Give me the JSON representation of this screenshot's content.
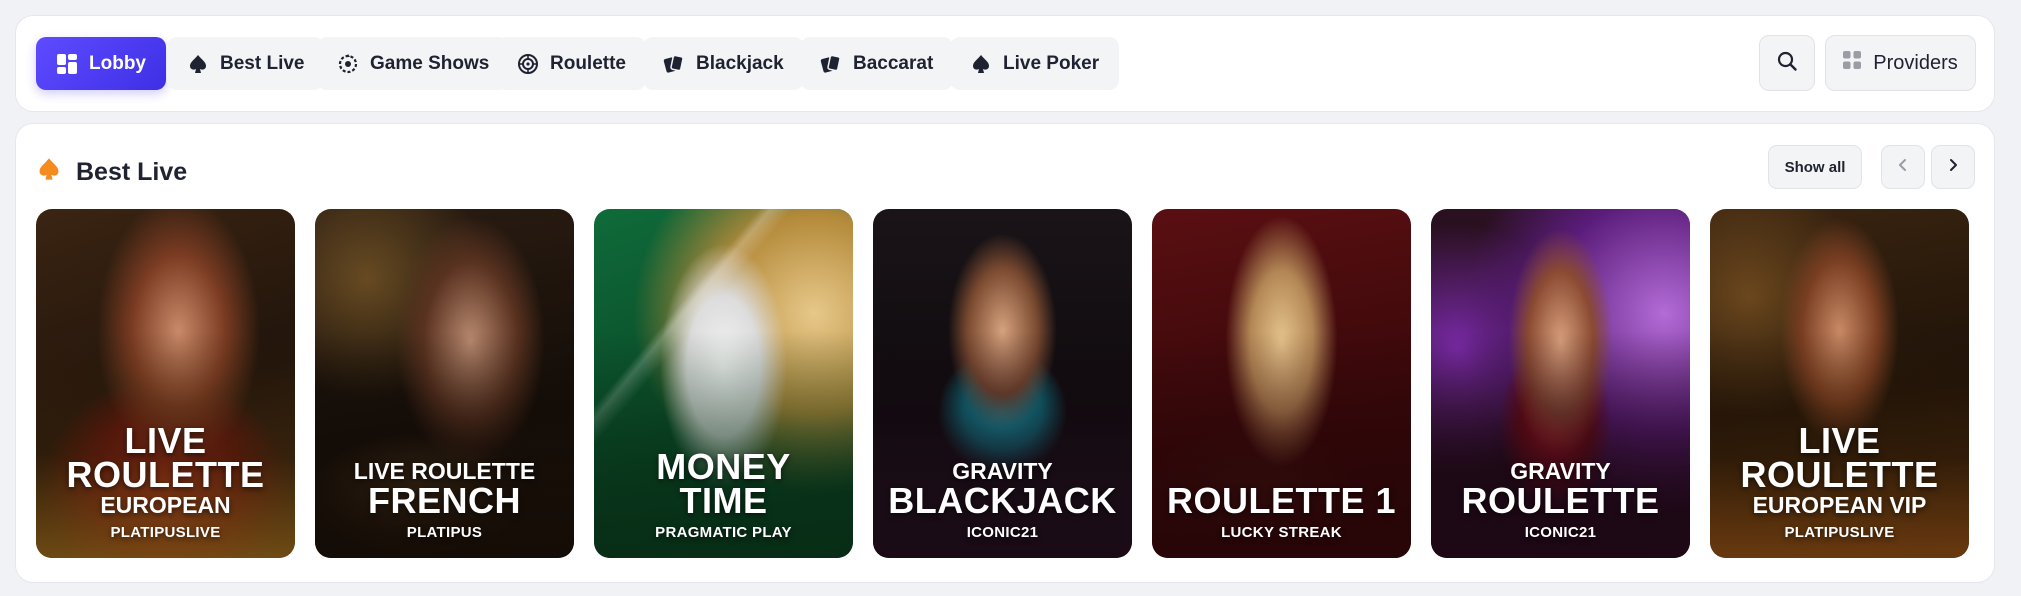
{
  "nav": {
    "tabs": [
      {
        "label": "Lobby",
        "icon": "grid-icon",
        "active": true
      },
      {
        "label": "Best Live",
        "icon": "spade-icon",
        "active": false
      },
      {
        "label": "Game Shows",
        "icon": "wheel-icon",
        "active": false
      },
      {
        "label": "Roulette",
        "icon": "roulette-icon",
        "active": false
      },
      {
        "label": "Blackjack",
        "icon": "cards-icon",
        "active": false
      },
      {
        "label": "Baccarat",
        "icon": "cards-icon",
        "active": false
      },
      {
        "label": "Live Poker",
        "icon": "spade-icon",
        "active": false
      }
    ],
    "search_icon": "search-icon",
    "providers_label": "Providers"
  },
  "section": {
    "title": "Best Live",
    "icon": "spade-icon",
    "accent_color": "#f58a1f",
    "show_all_label": "Show all"
  },
  "games": [
    {
      "lines": [
        "LIVE",
        "ROULETTE",
        "EUROPEAN"
      ],
      "provider": "PLATIPUSLIVE",
      "theme": "red-gold"
    },
    {
      "lines": [
        "LIVE ROULETTE",
        "FRENCH"
      ],
      "provider": "PLATIPUS",
      "theme": "dark-gold"
    },
    {
      "lines": [
        "MONEY",
        "TIME"
      ],
      "provider": "PRAGMATIC PLAY",
      "theme": "green"
    },
    {
      "lines": [
        "GRAVITY",
        "BLACKJACK"
      ],
      "provider": "ICONIC21",
      "theme": "teal-dark"
    },
    {
      "lines": [
        "ROULETTE 1"
      ],
      "provider": "LUCKY STREAK",
      "theme": "crimson"
    },
    {
      "lines": [
        "GRAVITY",
        "ROULETTE"
      ],
      "provider": "ICONIC21",
      "theme": "purple-gold"
    },
    {
      "lines": [
        "LIVE",
        "ROULETTE",
        "EUROPEAN VIP"
      ],
      "provider": "PLATIPUSLIVE",
      "theme": "bronze"
    }
  ],
  "colors": {
    "active_tab": "#4b3cf2",
    "background": "#f1f2f6",
    "panel": "#ffffff"
  }
}
